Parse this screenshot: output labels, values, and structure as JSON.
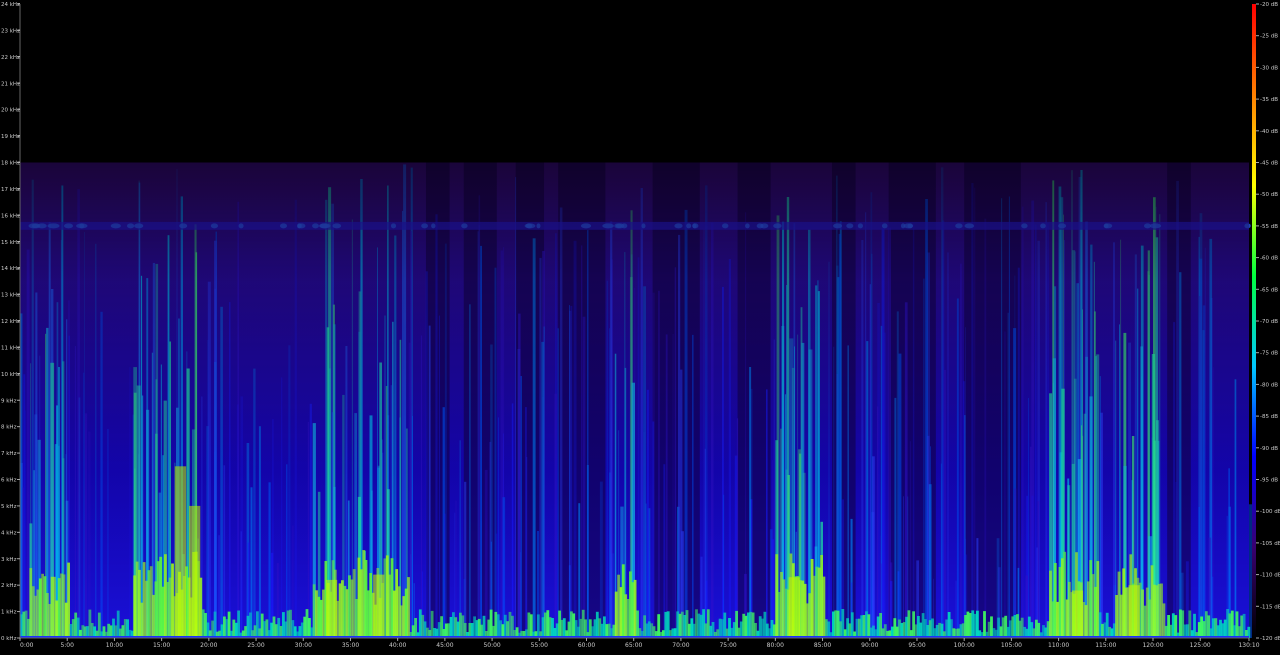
{
  "chart_data": {
    "type": "heatmap",
    "title": "",
    "xlabel": "",
    "ylabel": "",
    "x_ticks": [
      "0:00",
      "5:00",
      "10:00",
      "15:00",
      "20:00",
      "25:00",
      "30:00",
      "35:00",
      "40:00",
      "45:00",
      "50:00",
      "55:00",
      "60:00",
      "65:00",
      "70:00",
      "75:00",
      "80:00",
      "85:00",
      "90:00",
      "95:00",
      "100:00",
      "105:00",
      "110:00",
      "115:00",
      "120:00",
      "125:00",
      "130:10"
    ],
    "x_range_minutes": [
      0,
      130.1667
    ],
    "y_ticks": [
      "0 kHz",
      "1 kHz",
      "2 kHz",
      "3 kHz",
      "4 kHz",
      "5 kHz",
      "6 kHz",
      "7 kHz",
      "8 kHz",
      "9 kHz",
      "10 kHz",
      "11 kHz",
      "12 kHz",
      "13 kHz",
      "14 kHz",
      "15 kHz",
      "16 kHz",
      "17 kHz",
      "18 kHz",
      "19 kHz",
      "20 kHz",
      "21 kHz",
      "22 kHz",
      "23 kHz",
      "24 kHz"
    ],
    "y_range_khz": [
      0,
      24
    ],
    "frequency_cutoff_khz": 18,
    "colorbar_ticks": [
      "-20 dB",
      "-25 dB",
      "-30 dB",
      "-35 dB",
      "-40 dB",
      "-45 dB",
      "-50 dB",
      "-55 dB",
      "-60 dB",
      "-65 dB",
      "-70 dB",
      "-75 dB",
      "-80 dB",
      "-85 dB",
      "-90 dB",
      "-95 dB",
      "-100 dB",
      "-105 dB",
      "-110 dB",
      "-115 dB",
      "-120 dB"
    ],
    "colorbar_range_db": [
      -120,
      -20
    ],
    "colorbar_colors": [
      "#000000",
      "#3a0070",
      "#0000ff",
      "#00c8ff",
      "#00ff40",
      "#ffff00",
      "#ff8000",
      "#ff0000"
    ],
    "loud_segments_minutes": [
      [
        1,
        5
      ],
      [
        12,
        19
      ],
      [
        31,
        41
      ],
      [
        63,
        65
      ],
      [
        80,
        85
      ],
      [
        109,
        114
      ],
      [
        116,
        121
      ]
    ]
  }
}
